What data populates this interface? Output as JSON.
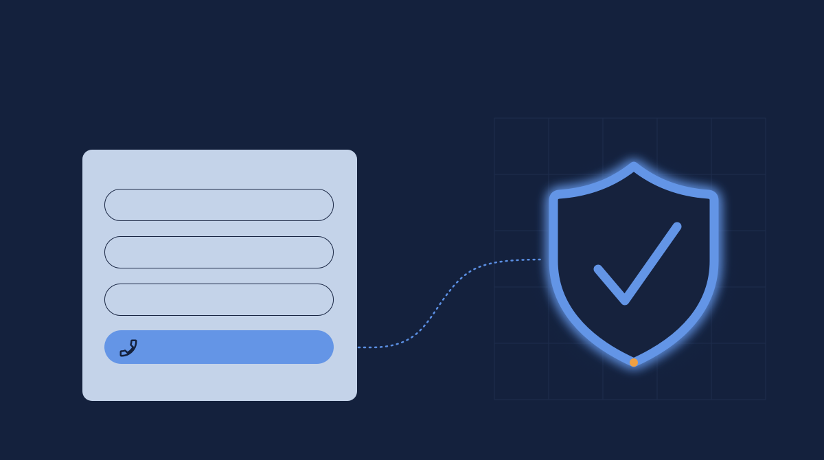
{
  "illustration": {
    "form": {
      "fields": [
        {
          "value": ""
        },
        {
          "value": ""
        },
        {
          "value": ""
        }
      ],
      "phone_field": {
        "icon": "phone-icon",
        "value": ""
      }
    },
    "shield": {
      "icon": "shield-check-icon"
    },
    "colors": {
      "background": "#14213d",
      "card": "#c4d3e9",
      "accent": "#6495e6",
      "dot": "#f0a042"
    }
  }
}
